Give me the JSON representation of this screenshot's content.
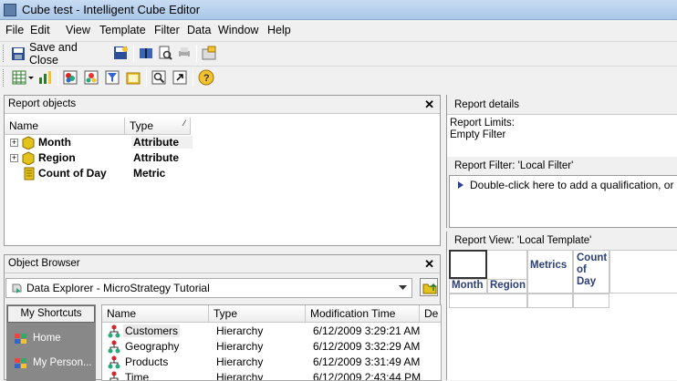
{
  "window": {
    "title": "Cube test - Intelligent Cube Editor"
  },
  "menu": [
    "File",
    "Edit",
    "View",
    "Template",
    "Filter",
    "Data",
    "Window",
    "Help"
  ],
  "toolbar": {
    "save_close_label": "Save and Close"
  },
  "report_objects": {
    "title": "Report objects",
    "columns": {
      "name": "Name",
      "type": "Type"
    },
    "rows": [
      {
        "name": "Month",
        "type": "Attribute"
      },
      {
        "name": "Region",
        "type": "Attribute"
      },
      {
        "name": "Count of Day",
        "type": "Metric"
      }
    ]
  },
  "report_details": {
    "title": "Report details",
    "line1": "Report Limits:",
    "line2": "Empty Filter"
  },
  "report_filter": {
    "title": "Report Filter: 'Local Filter'",
    "hint": "Double-click here to add a qualification, or dr"
  },
  "report_view": {
    "title": "Report View: 'Local Template'",
    "metrics_label": "Metrics",
    "metric_col": "Count of Day",
    "row_headers": [
      "Month",
      "Region"
    ]
  },
  "object_browser": {
    "title": "Object Browser",
    "location": "Data Explorer - MicroStrategy Tutorial",
    "shortcuts_tab": "My Shortcuts",
    "shortcuts": [
      "Home",
      "My Person..."
    ],
    "columns": {
      "name": "Name",
      "type": "Type",
      "modified": "Modification Time",
      "desc": "De"
    },
    "rows": [
      {
        "name": "Customers",
        "type": "Hierarchy",
        "modified": "6/12/2009 3:29:21 AM"
      },
      {
        "name": "Geography",
        "type": "Hierarchy",
        "modified": "6/12/2009 3:32:29 AM"
      },
      {
        "name": "Products",
        "type": "Hierarchy",
        "modified": "6/12/2009 3:31:49 AM"
      },
      {
        "name": "Time",
        "type": "Hierarchy",
        "modified": "6/12/2009 2:43:44 PM"
      }
    ]
  }
}
